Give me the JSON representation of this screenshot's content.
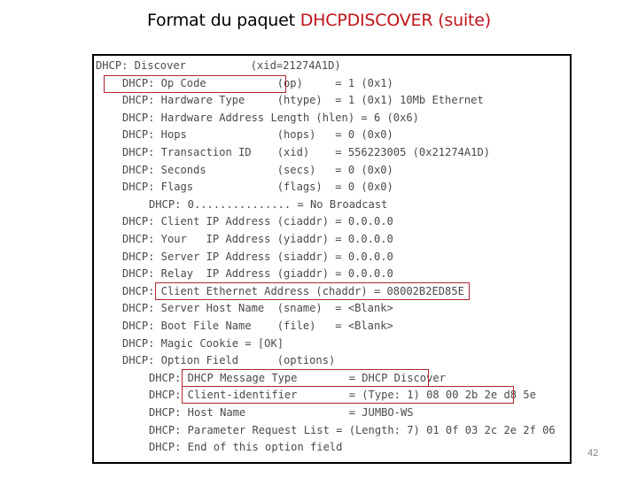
{
  "slide": {
    "title_prefix": "Format du paquet ",
    "title_accent": "DHCPDISCOVER (suite)",
    "accent_color": "#c0141a",
    "page_number": "42"
  },
  "capture": {
    "lines": [
      {
        "indent": 0,
        "text": "DHCP: Discover          (xid=21274A1D)",
        "highlighted": false
      },
      {
        "indent": 1,
        "text": "DHCP: Op Code           (op)     = 1 (0x1)",
        "highlighted": true
      },
      {
        "indent": 1,
        "text": "DHCP: Hardware Type     (htype)  = 1 (0x1) 10Mb Ethernet",
        "highlighted": false
      },
      {
        "indent": 1,
        "text": "DHCP: Hardware Address Length (hlen) = 6 (0x6)",
        "highlighted": false
      },
      {
        "indent": 1,
        "text": "DHCP: Hops              (hops)   = 0 (0x0)",
        "highlighted": false
      },
      {
        "indent": 1,
        "text": "DHCP: Transaction ID    (xid)    = 556223005 (0x21274A1D)",
        "highlighted": false
      },
      {
        "indent": 1,
        "text": "DHCP: Seconds           (secs)   = 0 (0x0)",
        "highlighted": false
      },
      {
        "indent": 1,
        "text": "DHCP: Flags             (flags)  = 0 (0x0)",
        "highlighted": false
      },
      {
        "indent": 2,
        "text": "DHCP: 0............... = No Broadcast",
        "highlighted": false
      },
      {
        "indent": 1,
        "text": "DHCP: Client IP Address (ciaddr) = 0.0.0.0",
        "highlighted": false
      },
      {
        "indent": 1,
        "text": "DHCP: Your   IP Address (yiaddr) = 0.0.0.0",
        "highlighted": false
      },
      {
        "indent": 1,
        "text": "DHCP: Server IP Address (siaddr) = 0.0.0.0",
        "highlighted": false
      },
      {
        "indent": 1,
        "text": "DHCP: Relay  IP Address (giaddr) = 0.0.0.0",
        "highlighted": false
      },
      {
        "indent": 1,
        "text": "DHCP: Client Ethernet Address (chaddr) = 08002B2ED85E",
        "highlighted": true
      },
      {
        "indent": 1,
        "text": "DHCP: Server Host Name  (sname)  = <Blank>",
        "highlighted": false
      },
      {
        "indent": 1,
        "text": "DHCP: Boot File Name    (file)   = <Blank>",
        "highlighted": false
      },
      {
        "indent": 1,
        "text": "DHCP: Magic Cookie = [OK]",
        "highlighted": false
      },
      {
        "indent": 1,
        "text": "DHCP: Option Field      (options)",
        "highlighted": false
      },
      {
        "indent": 2,
        "text": "DHCP: DHCP Message Type        = DHCP Discover",
        "highlighted": true
      },
      {
        "indent": 2,
        "text": "DHCP: Client-identifier        = (Type: 1) 08 00 2b 2e d8 5e",
        "highlighted": true
      },
      {
        "indent": 2,
        "text": "DHCP: Host Name                = JUMBO-WS",
        "highlighted": false
      },
      {
        "indent": 2,
        "text": "DHCP: Parameter Request List = (Length: 7) 01 0f 03 2c 2e 2f 06",
        "highlighted": false
      },
      {
        "indent": 2,
        "text": "DHCP: End of this option field",
        "highlighted": false
      }
    ]
  }
}
